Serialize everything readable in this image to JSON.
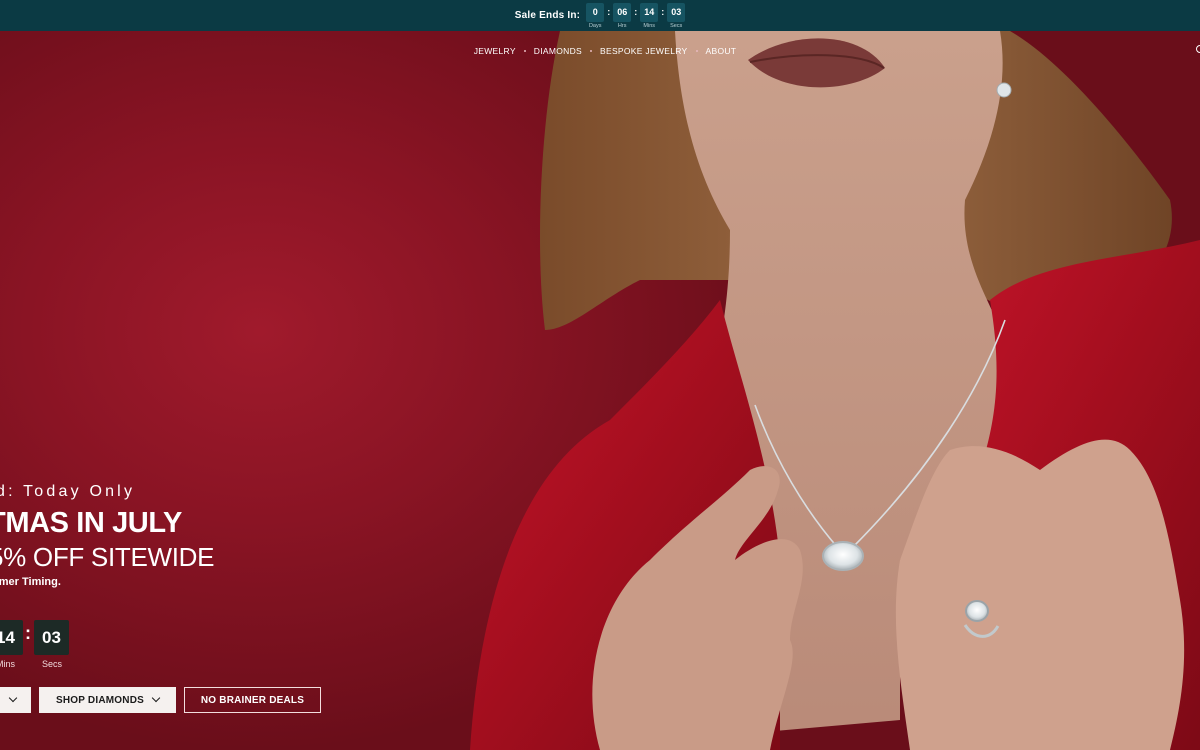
{
  "topbar": {
    "label": "Sale Ends In:",
    "units": [
      {
        "value": "0",
        "caption": "Days"
      },
      {
        "value": "06",
        "caption": "Hrs"
      },
      {
        "value": "14",
        "caption": "Mins"
      },
      {
        "value": "03",
        "caption": "Secs"
      }
    ]
  },
  "nav": {
    "items": [
      "JEWELRY",
      "DIAMONDS",
      "BESPOKE JEWELRY",
      "ABOUT"
    ]
  },
  "hero": {
    "eyebrow": "d: Today Only",
    "headline": "TMAS IN JULY",
    "subhead": "5% OFF SITEWIDE",
    "fineprint": "mmer Timing.",
    "countdown": [
      {
        "value": "14",
        "caption": "Mins"
      },
      {
        "value": "03",
        "caption": "Secs"
      }
    ],
    "separator": ":",
    "buttons": {
      "shop_diamonds": "SHOP DIAMONDS",
      "no_brainer": "NO BRAINER DEALS"
    }
  },
  "colors": {
    "topbar_bg": "#0b3a44",
    "hero_red": "#8a1424",
    "blazer_red": "#b3111f",
    "countdown_box": "#1d2a26"
  }
}
